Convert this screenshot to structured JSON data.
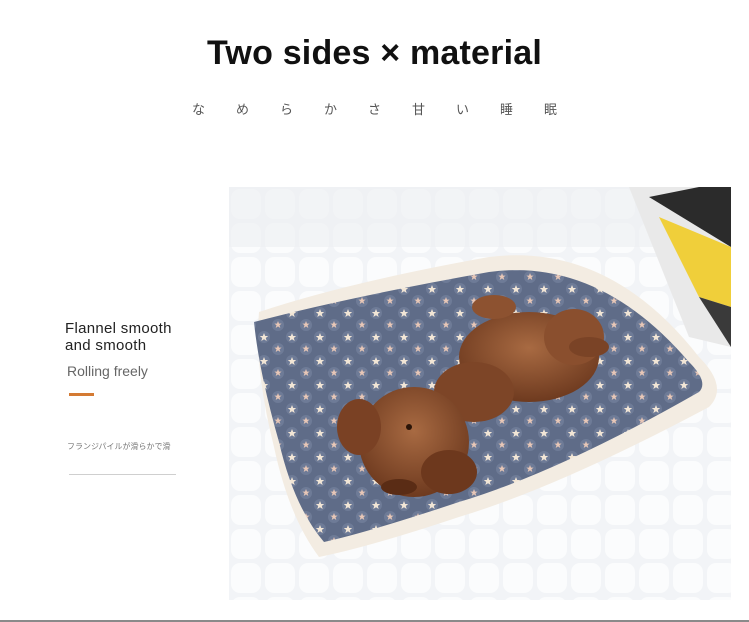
{
  "header": {
    "title": "Two sides × material",
    "subtitle": "なめらかさ甘い睡眠"
  },
  "feature": {
    "heading": "Flannel smooth and smooth",
    "tagline": "Rolling freely",
    "accent_color": "#d47a33",
    "note": "フランジパイルが滑らかで滑"
  },
  "photo": {
    "subject": "dog-on-star-pattern-blanket",
    "colors": {
      "blanket": "#5e6b86",
      "dog": "#8a4f2e",
      "sherpa_edge": "#f3ece2",
      "bed": "#eef0f3"
    }
  }
}
